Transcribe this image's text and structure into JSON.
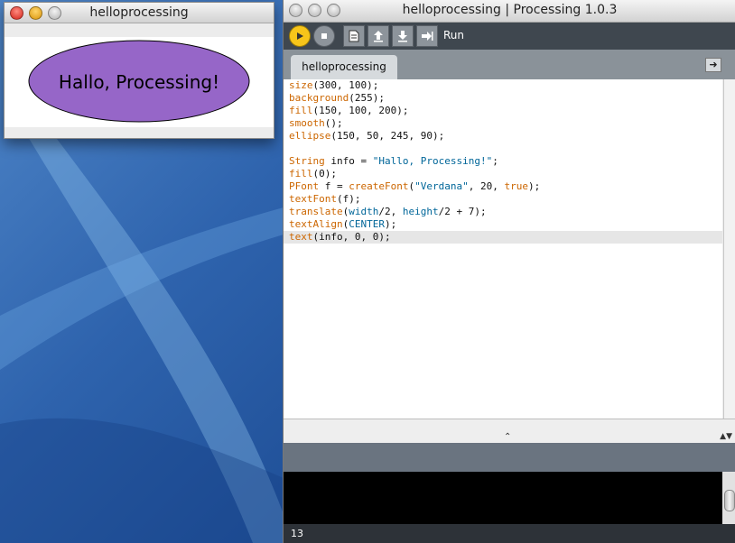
{
  "sketch_window": {
    "title": "helloprocessing",
    "greeting": "Hallo, Processing!",
    "ellipse_fill": "#9666c8"
  },
  "ide_window": {
    "title": "helloprocessing | Processing 1.0.3",
    "toolbar": {
      "run_label": "Run",
      "buttons": [
        "run-icon",
        "stop-icon",
        "new-icon",
        "open-icon",
        "save-icon",
        "export-icon"
      ]
    },
    "tab_label": "helloprocessing",
    "code": [
      "size(300, 100);",
      "background(255);",
      "fill(150, 100, 200);",
      "smooth();",
      "ellipse(150, 50, 245, 90);",
      "",
      "String info = \"Hallo, Processing!\";",
      "fill(0);",
      "PFont f = createFont(\"Verdana\", 20, true);",
      "textFont(f);",
      "translate(width/2, height/2 + 7);",
      "textAlign(CENTER);",
      "text(info, 0, 0);"
    ],
    "active_line": 13,
    "status_line_number": "13"
  },
  "colors": {
    "run_button": "#f7c51a",
    "toolbar_bg": "#3f474f",
    "keyword": "#cc6600",
    "string_literal": "#006699"
  }
}
